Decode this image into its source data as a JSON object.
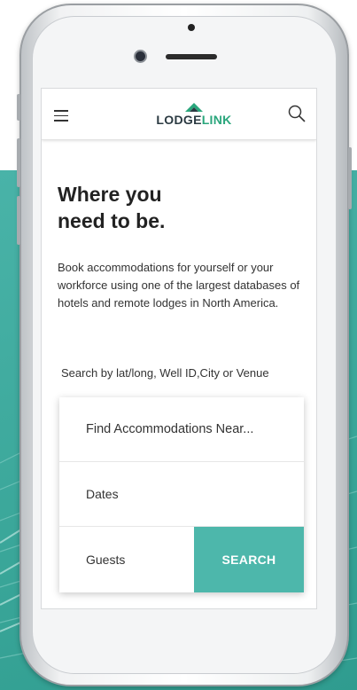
{
  "header": {
    "logo_lodge": "LODGE",
    "logo_link": "LINK",
    "menu_icon": "hamburger-menu-icon",
    "search_icon": "magnifier-search-icon"
  },
  "hero": {
    "title_line1": "Where you",
    "title_line2": "need to be.",
    "description": "Book accommodations for yourself or your workforce using one of the largest databases of hotels and remote lodges in North America."
  },
  "search": {
    "hint": "Search by lat/long, Well ID,City or Venue",
    "location_placeholder": "Find Accommodations Near...",
    "dates_label": "Dates",
    "guests_label": "Guests",
    "button_label": "SEARCH"
  },
  "colors": {
    "accent": "#4db7ab",
    "background_teal": "#3aa699",
    "logo_green": "#2aa67c",
    "logo_dark": "#2b3a42"
  }
}
